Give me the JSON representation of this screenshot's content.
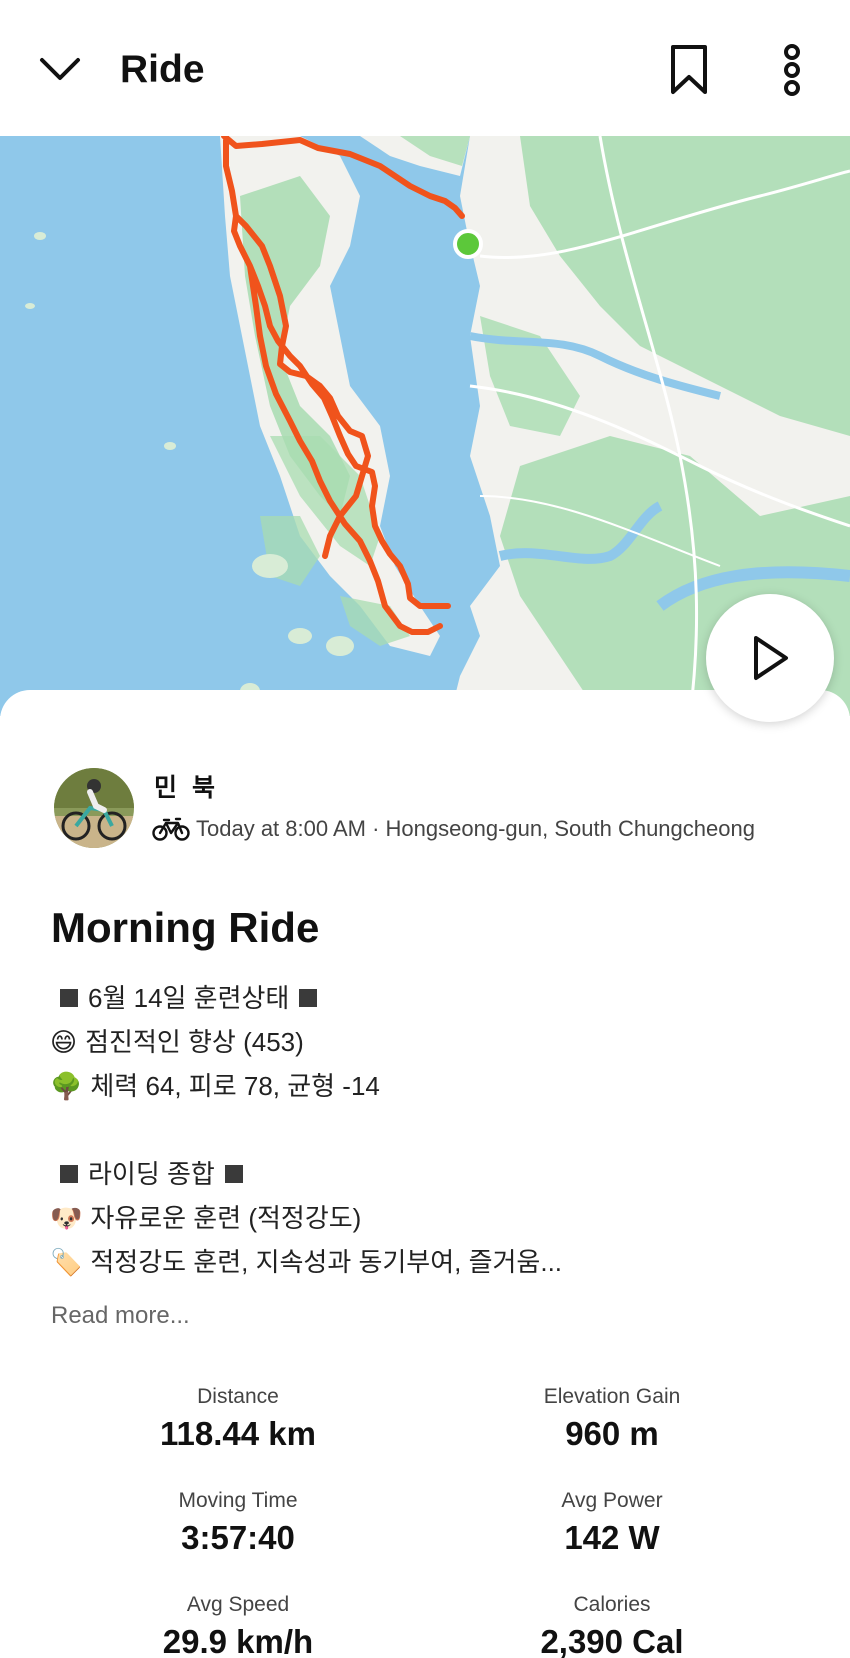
{
  "header": {
    "title": "Ride"
  },
  "athlete": {
    "name": "민 북",
    "meta": "Today at 8:00 AM · Hongseong-gun, South Chungcheong"
  },
  "activity": {
    "title": "Morning Ride",
    "description": {
      "line1_text": "6월 14일 훈련상태",
      "line2_text": "점진적인 향상 (453)",
      "line2_emoji": "😄",
      "line3_text": "체력 64, 피로 78, 균형 -14",
      "line3_emoji": "🌳",
      "line4_text": "라이딩 종합",
      "line5_text": "자유로운 훈련 (적정강도)",
      "line5_emoji": "🐶",
      "line6_text": "적정강도 훈련, 지속성과 동기부여, 즐거움...",
      "line6_emoji": "🏷️"
    },
    "read_more": "Read more..."
  },
  "stats": [
    {
      "label": "Distance",
      "value": "118.44 km"
    },
    {
      "label": "Elevation Gain",
      "value": "960 m"
    },
    {
      "label": "Moving Time",
      "value": "3:57:40"
    },
    {
      "label": "Avg Power",
      "value": "142 W"
    },
    {
      "label": "Avg Speed",
      "value": "29.9 km/h"
    },
    {
      "label": "Calories",
      "value": "2,390 Cal"
    }
  ],
  "colors": {
    "route": "#f0531c",
    "start_marker": "#5cc83a",
    "water": "#8fc8ea",
    "land": "#f2f2ee",
    "vegetation": "#a8dcb0"
  },
  "icons": {
    "back": "chevron-down-icon",
    "bookmark": "bookmark-icon",
    "more": "more-vertical-icon",
    "play": "play-icon",
    "sport": "bike-icon"
  }
}
